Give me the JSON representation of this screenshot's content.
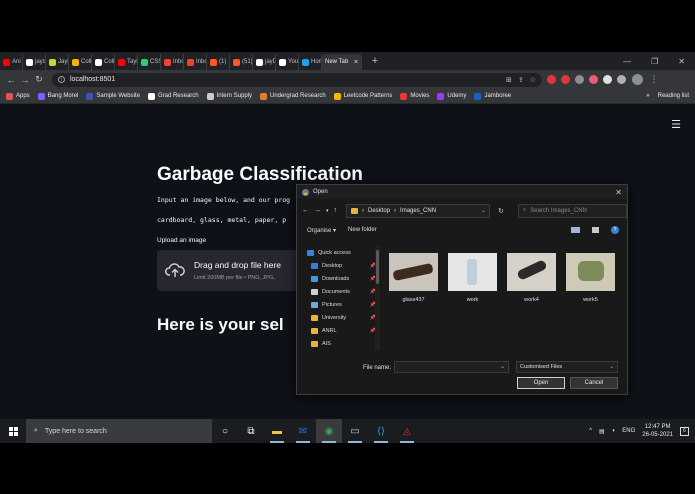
{
  "browser": {
    "tabs": [
      {
        "label": "Ani",
        "color": "#ff0000"
      },
      {
        "label": "jaysl",
        "color": "#ffffff"
      },
      {
        "label": "Jayl",
        "color": "#c3d834"
      },
      {
        "label": "Coll",
        "color": "#f4b400"
      },
      {
        "label": "Coll",
        "color": "#ffffff"
      },
      {
        "label": "Tayl",
        "color": "#ff0000"
      },
      {
        "label": "CSS",
        "color": "#2ecc71"
      },
      {
        "label": "Inbo",
        "color": "#ea4335"
      },
      {
        "label": "Inbo",
        "color": "#ea4335"
      },
      {
        "label": "(1)",
        "color": "#ff5722"
      },
      {
        "label": "(51)",
        "color": "#ff5722"
      },
      {
        "label": "jayD",
        "color": "#ffffff"
      },
      {
        "label": "Your",
        "color": "#ffffff"
      },
      {
        "label": "Hom",
        "color": "#1da1f2"
      }
    ],
    "active_tab": {
      "label": "New Tab",
      "close": "×"
    },
    "new_tab": "+",
    "window_controls": {
      "minimize": "—",
      "maximize": "❐",
      "close": "✕"
    },
    "url": "localhost:8501",
    "nav": {
      "back": "←",
      "forward": "→",
      "reload": "↻"
    },
    "omnibox_right": {
      "install": "⊞",
      "share": "⇪",
      "star": "☆"
    },
    "extension_colors": [
      "#e8333c",
      "#d63b3b",
      "#8f8f8f",
      "#e85d75",
      "#e0e0e0",
      "#b0b0b0"
    ],
    "menu_dots": "⋮",
    "bookmarks": [
      {
        "label": "Apps",
        "color": "#e25555"
      },
      {
        "label": "Bang Morel",
        "color": "#7b61ff"
      },
      {
        "label": "Sample Website",
        "color": "#3f51b5"
      },
      {
        "label": "Grad Research",
        "color": "#ffffff"
      },
      {
        "label": "Intern Supply",
        "color": "#cccccc"
      },
      {
        "label": "Undergrad Research",
        "color": "#d9822b"
      },
      {
        "label": "Leetcode Patterns",
        "color": "#f5b700"
      },
      {
        "label": "Movies",
        "color": "#e53935"
      },
      {
        "label": "Udemy",
        "color": "#a435f0"
      },
      {
        "label": "Jamboree",
        "color": "#1565c0"
      }
    ],
    "bookmarks_more": "»",
    "reading_list": "Reading list"
  },
  "app": {
    "hamburger": "☰",
    "title": "Garbage Classification",
    "intro_line1": "Input an image below, and our prog",
    "intro_line2": "cardboard, glass, metal, paper, p",
    "upload_label": "Upload an image",
    "drop_title": "Drag and drop file here",
    "drop_hint": "Limit 200MB per file • PNG, JPG,",
    "section_title": "Here is your sel"
  },
  "dialog": {
    "title": "Open",
    "close": "✕",
    "path": [
      "Desktop",
      "Images_CNN"
    ],
    "path_sep": "›",
    "search_placeholder": "Search Images_CNN",
    "organise": "Organise ▾",
    "new_folder": "New folder",
    "nav_items": [
      {
        "label": "Quick access",
        "color": "#3b82d6",
        "pinned": false
      },
      {
        "label": "Desktop",
        "color": "#3a7bd5",
        "pinned": true
      },
      {
        "label": "Downloads",
        "color": "#3a9be0",
        "pinned": true
      },
      {
        "label": "Documents",
        "color": "#d0d0d0",
        "pinned": true
      },
      {
        "label": "Pictures",
        "color": "#6fa8dc",
        "pinned": true
      },
      {
        "label": "University",
        "color": "#e6b43c",
        "pinned": true
      },
      {
        "label": "ANRL",
        "color": "#e6b43c",
        "pinned": true
      },
      {
        "label": "AIS",
        "color": "#e6b43c",
        "pinned": false
      }
    ],
    "pin_glyph": "📌",
    "files": [
      {
        "name": "glass437",
        "bg": "#c9c4bc",
        "obj": "#3d2a1e"
      },
      {
        "name": "work",
        "bg": "#e4e6e8",
        "obj": "#b8c8d6"
      },
      {
        "name": "work4",
        "bg": "#d6d2ca",
        "obj": "#2a2a2a"
      },
      {
        "name": "work5",
        "bg": "#cfcab6",
        "obj": "#7d8a5a"
      }
    ],
    "filename_label": "File name:",
    "filename_value": "",
    "filetype": "Customised Files",
    "open_button": "Open",
    "cancel_button": "Cancel"
  },
  "taskbar": {
    "search_placeholder": "Type here to search",
    "apps": [
      {
        "name": "task-view",
        "glyph": "○",
        "color": "#ffffff"
      },
      {
        "name": "widgets",
        "glyph": "⧉",
        "color": "#ffffff"
      },
      {
        "name": "file-explorer",
        "glyph": "▬",
        "color": "#f0c24b"
      },
      {
        "name": "outlook",
        "glyph": "✉",
        "color": "#1a73e8"
      },
      {
        "name": "chrome",
        "glyph": "◉",
        "color": "#34a853"
      },
      {
        "name": "terminal",
        "glyph": "▭",
        "color": "#cccccc"
      },
      {
        "name": "vscode",
        "glyph": "⟨⟩",
        "color": "#23a8f2"
      },
      {
        "name": "acrobat",
        "glyph": "◬",
        "color": "#e02a2a"
      }
    ],
    "tray": {
      "chevron": "^",
      "language": "ENG",
      "time": "12:47 PM",
      "date": "26-05-2021",
      "notifications": "6"
    }
  }
}
